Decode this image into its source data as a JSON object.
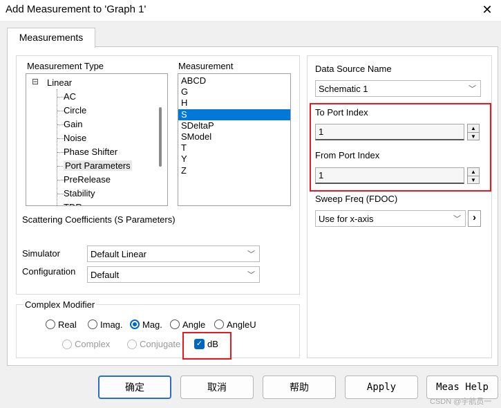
{
  "window": {
    "title": "Add Measurement to 'Graph 1'",
    "close_glyph": "✕"
  },
  "tab": {
    "label": "Measurements"
  },
  "measurement_type": {
    "label": "Measurement Type",
    "tree": {
      "root": "Linear",
      "root_toggle": "⊟",
      "children": [
        "AC",
        "Circle",
        "Gain",
        "Noise",
        "Phase Shifter",
        "Port Parameters",
        "PreRelease",
        "Stability",
        "TDR"
      ]
    }
  },
  "measurement": {
    "label": "Measurement",
    "items": [
      "ABCD",
      "G",
      "H",
      "S",
      "SDeltaP",
      "SModel",
      "T",
      "Y",
      "Z"
    ],
    "selected": "S"
  },
  "description": "Scattering Coefficients (S Parameters)",
  "simulator": {
    "label": "Simulator",
    "value": "Default Linear"
  },
  "configuration": {
    "label": "Configuration",
    "value": "Default"
  },
  "complex_modifier": {
    "label": "Complex Modifier",
    "options": [
      "Real",
      "Imag.",
      "Mag.",
      "Angle",
      "AngleU"
    ],
    "selected": "Mag.",
    "disabled_options": [
      "Complex",
      "Conjugate"
    ],
    "db_label": "dB",
    "db_checked": true
  },
  "data_source": {
    "label": "Data Source Name",
    "value": "Schematic 1"
  },
  "to_port": {
    "label": "To Port Index",
    "value": "1"
  },
  "from_port": {
    "label": "From Port Index",
    "value": "1"
  },
  "sweep_freq": {
    "label": "Sweep Freq (FDOC)",
    "value": "Use for x-axis",
    "arrow": "›"
  },
  "buttons": {
    "ok": "确定",
    "cancel": "取消",
    "help": "帮助",
    "apply": "Apply",
    "meas_help": "Meas Help"
  },
  "watermark": "CSDN @宇航员一",
  "colors": {
    "highlight": "#e8191e",
    "selection": "#0078d7",
    "accent": "#0067c0"
  }
}
